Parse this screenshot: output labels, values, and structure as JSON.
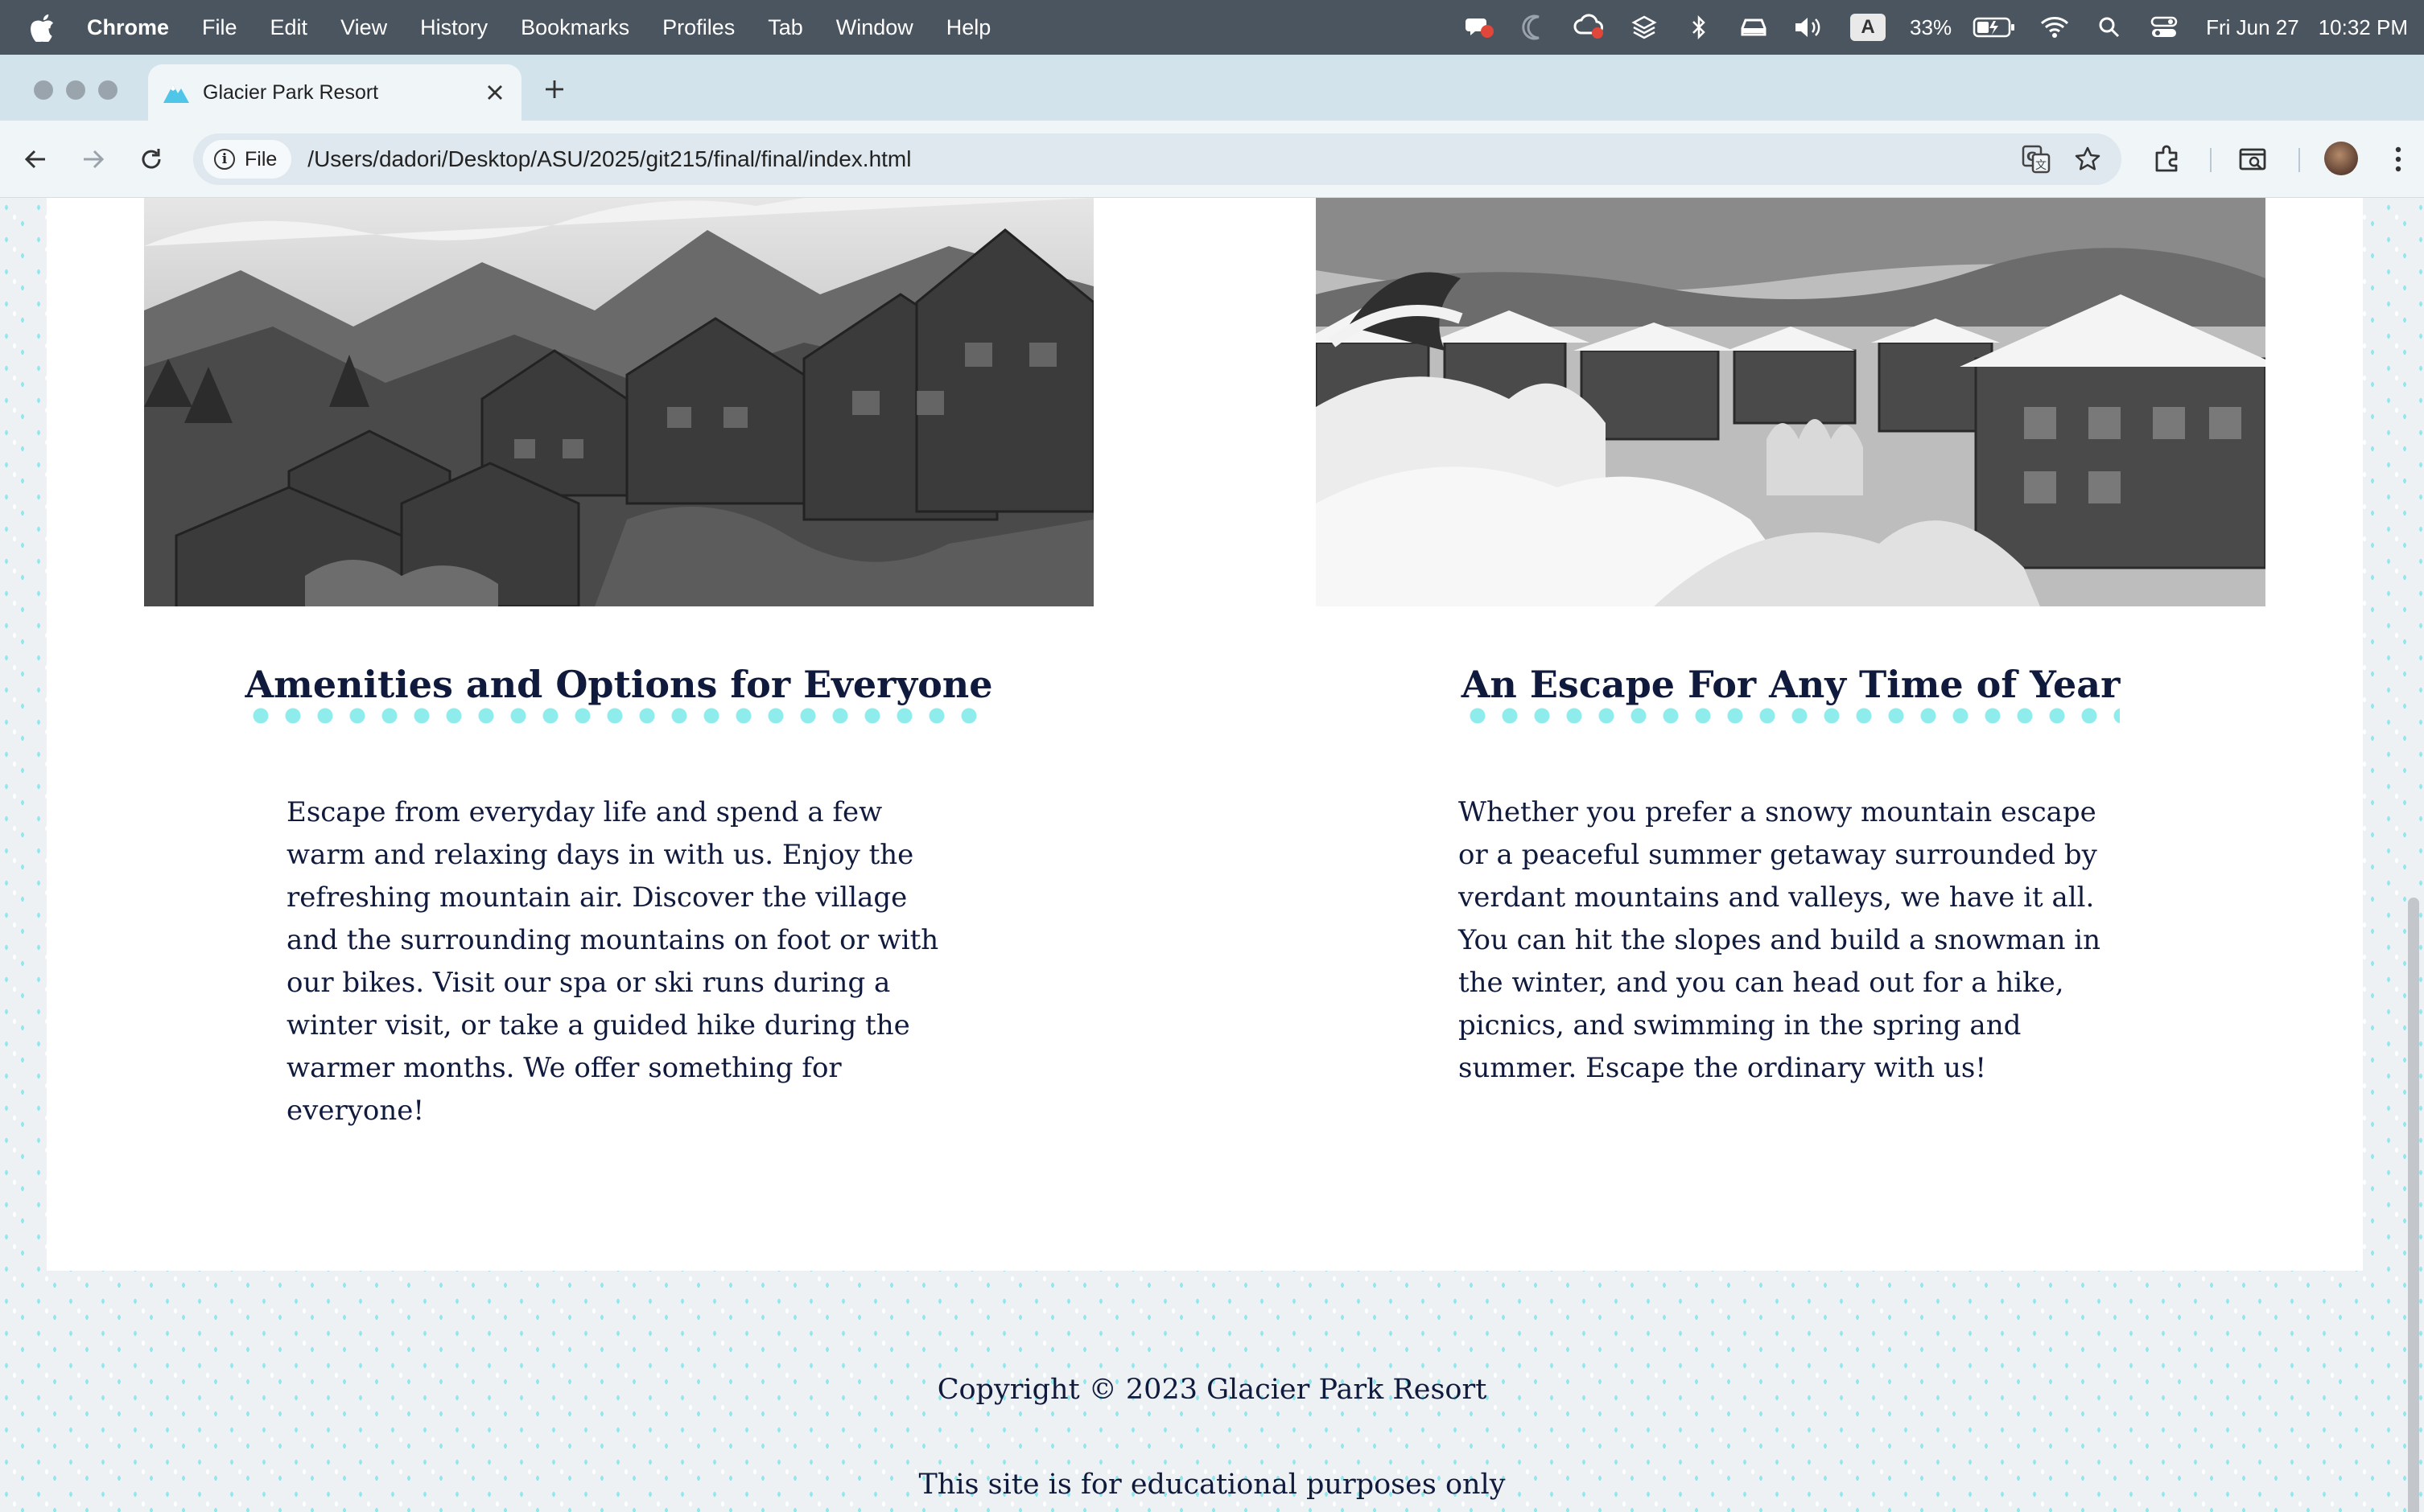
{
  "menubar": {
    "items": [
      "Chrome",
      "File",
      "Edit",
      "View",
      "History",
      "Bookmarks",
      "Profiles",
      "Tab",
      "Window",
      "Help"
    ],
    "battery": "33%",
    "input_source": "A",
    "date": "Fri Jun 27",
    "time": "10:32 PM"
  },
  "browser": {
    "tab_title": "Glacier Park Resort",
    "url_chip": "File",
    "url": "/Users/dadori/Desktop/ASU/2025/git215/final/final/index.html"
  },
  "page": {
    "left": {
      "title": "Amenities and Options for Everyone",
      "body": "Escape from everyday life and spend a few warm and relaxing days in with us. Enjoy the refreshing mountain air. Discover the village and the surrounding mountains on foot or with our bikes. Visit our spa or ski runs during a winter visit, or take a guided hike during the warmer months. We offer something for everyone!"
    },
    "right": {
      "title": "An Escape For Any Time of Year",
      "body": "Whether you prefer a snowy mountain escape or a peaceful summer getaway surrounded by verdant mountains and valleys, we have it all. You can hit the slopes and build a snowman in the winter, and you can head out for a hike, picnics, and swimming in the spring and summer. Escape the ordinary with us!"
    },
    "footer": {
      "copyright": "Copyright © 2023 Glacier Park Resort",
      "note": "This site is for educational purposes only"
    }
  },
  "colors": {
    "heading": "#101a3c",
    "accent_dots": "#8fecec",
    "menubar": "#4b5560",
    "tabstrip": "#d3e3ec"
  }
}
